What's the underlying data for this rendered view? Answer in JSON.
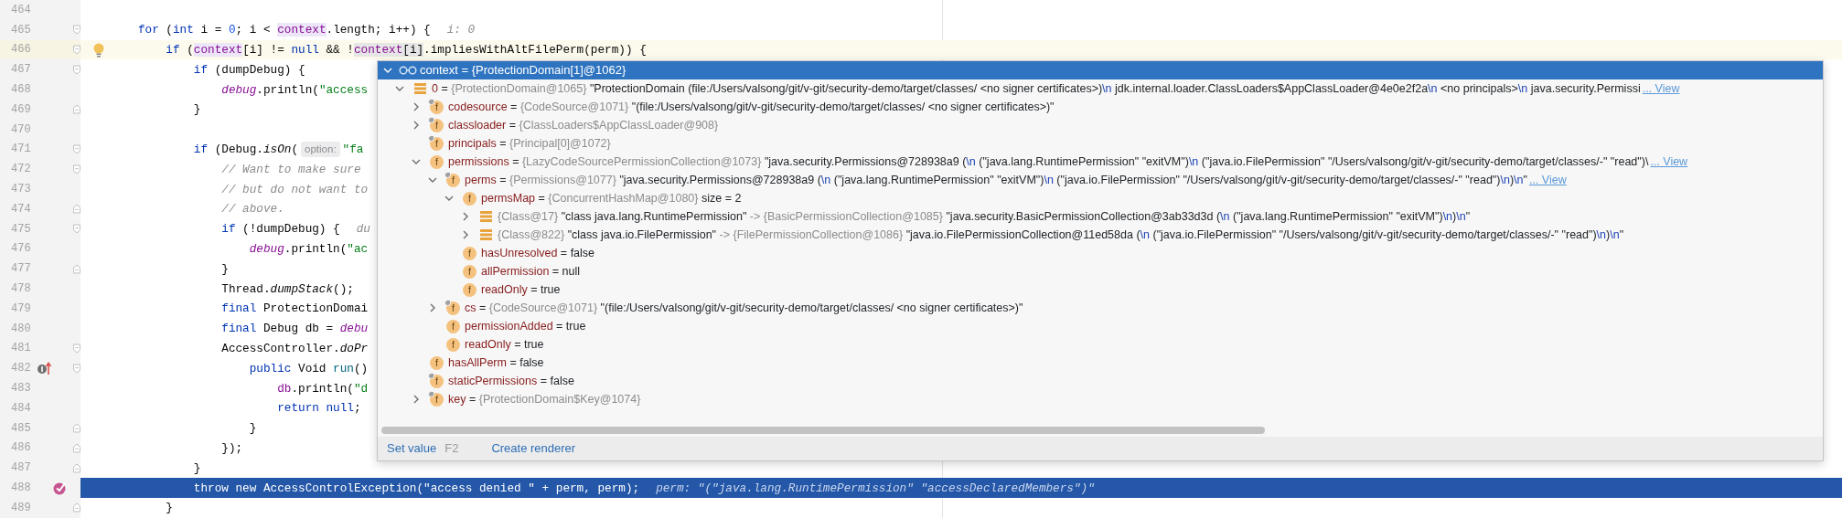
{
  "editor": {
    "lines": [
      {
        "number": "464",
        "caret_line": false,
        "selected": false
      },
      {
        "number": "465",
        "caret_line": false,
        "selected": false,
        "fold_marker": {
          "kind": "start"
        },
        "parts": [
          {
            "kind": "code",
            "tokens": [
              {
                "text": "for",
                "kind": "keyword"
              },
              {
                "text": " (",
                "kind": "plain"
              },
              {
                "text": "int",
                "kind": "keyword"
              },
              {
                "text": " i = ",
                "kind": "plain"
              },
              {
                "text": "0",
                "kind": "number"
              },
              {
                "text": "; i < ",
                "kind": "plain"
              },
              {
                "text": "context",
                "kind": "usage"
              },
              {
                "text": ".length; i++) {",
                "kind": "plain"
              }
            ]
          },
          {
            "kind": "value-hint",
            "text": "i: 0"
          }
        ],
        "children": [
          {
            "number": "466",
            "caret_line": true,
            "selected": false,
            "fold_marker": {
              "kind": "start"
            },
            "gutter_icon": {
              "kind": "bulb"
            },
            "parts": [
              {
                "kind": "code",
                "tokens": [
                  {
                    "text": "if",
                    "kind": "keyword"
                  },
                  {
                    "text": " (",
                    "kind": "plain"
                  },
                  {
                    "text": "context",
                    "kind": "usage"
                  },
                  {
                    "text": "[i] != ",
                    "kind": "plain"
                  },
                  {
                    "text": "null",
                    "kind": "keyword"
                  },
                  {
                    "text": " && !",
                    "kind": "plain"
                  },
                  {
                    "text": "context",
                    "kind": "evaluated-field"
                  },
                  {
                    "text": "[i]",
                    "kind": "evaluated"
                  },
                  {
                    "text": ".impliesWithAltFilePerm(perm)) {",
                    "kind": "plain"
                  }
                ]
              }
            ],
            "children": [
              {
                "number": "467",
                "caret_line": false,
                "selected": false,
                "fold_marker": {
                  "kind": "start"
                },
                "parts": [
                  {
                    "kind": "code",
                    "tokens": [
                      {
                        "text": "if",
                        "kind": "keyword"
                      },
                      {
                        "text": " (dumpDebug) {",
                        "kind": "plain"
                      }
                    ]
                  }
                ],
                "children": [
                  {
                    "number": "468",
                    "caret_line": false,
                    "selected": false,
                    "parts": [
                      {
                        "kind": "code",
                        "tokens": [
                          {
                            "text": "debug",
                            "kind": "static-field"
                          },
                          {
                            "text": ".println(",
                            "kind": "plain"
                          },
                          {
                            "text": "\"access",
                            "kind": "string"
                          }
                        ]
                      }
                    ]
                  }
                ]
              },
              {
                "number": "469",
                "caret_line": false,
                "selected": false,
                "fold_marker": {
                  "kind": "end"
                },
                "parts": [
                  {
                    "kind": "code",
                    "tokens": [
                      {
                        "text": "}",
                        "kind": "plain"
                      }
                    ]
                  }
                ]
              },
              {
                "number": "470",
                "caret_line": false,
                "selected": false
              },
              {
                "number": "471",
                "caret_line": false,
                "selected": false,
                "fold_marker": {
                  "kind": "start"
                },
                "parts": [
                  {
                    "kind": "code",
                    "tokens": [
                      {
                        "text": "if",
                        "kind": "keyword"
                      },
                      {
                        "text": " (Debug.",
                        "kind": "plain"
                      },
                      {
                        "text": "isOn",
                        "kind": "static-call"
                      },
                      {
                        "text": "(",
                        "kind": "plain"
                      }
                    ]
                  },
                  {
                    "kind": "param-hint",
                    "text": "option:"
                  },
                  {
                    "kind": "code",
                    "tokens": [
                      {
                        "text": "\"fa",
                        "kind": "string"
                      }
                    ]
                  }
                ],
                "children": [
                  {
                    "number": "472",
                    "caret_line": false,
                    "selected": false,
                    "fold_marker": {
                      "kind": "start"
                    },
                    "parts": [
                      {
                        "kind": "code",
                        "tokens": [
                          {
                            "text": "// Want to make sure",
                            "kind": "comment"
                          }
                        ]
                      }
                    ]
                  },
                  {
                    "number": "473",
                    "caret_line": false,
                    "selected": false,
                    "parts": [
                      {
                        "kind": "code",
                        "tokens": [
                          {
                            "text": "// but do not want to",
                            "kind": "comment"
                          }
                        ]
                      }
                    ]
                  },
                  {
                    "number": "474",
                    "caret_line": false,
                    "selected": false,
                    "fold_marker": {
                      "kind": "end"
                    },
                    "parts": [
                      {
                        "kind": "code",
                        "tokens": [
                          {
                            "text": "// above.",
                            "kind": "comment"
                          }
                        ]
                      }
                    ]
                  },
                  {
                    "number": "475",
                    "caret_line": false,
                    "selected": false,
                    "fold_marker": {
                      "kind": "start"
                    },
                    "parts": [
                      {
                        "kind": "code",
                        "tokens": [
                          {
                            "text": "if",
                            "kind": "keyword"
                          },
                          {
                            "text": " (!dumpDebug) {",
                            "kind": "plain"
                          }
                        ]
                      },
                      {
                        "kind": "value-hint",
                        "text": "du"
                      }
                    ],
                    "children": [
                      {
                        "number": "476",
                        "caret_line": false,
                        "selected": false,
                        "parts": [
                          {
                            "kind": "code",
                            "tokens": [
                              {
                                "text": "debug",
                                "kind": "static-field"
                              },
                              {
                                "text": ".println(",
                                "kind": "plain"
                              },
                              {
                                "text": "\"ac",
                                "kind": "string"
                              }
                            ]
                          }
                        ]
                      }
                    ]
                  },
                  {
                    "number": "477",
                    "caret_line": false,
                    "selected": false,
                    "fold_marker": {
                      "kind": "end"
                    },
                    "parts": [
                      {
                        "kind": "code",
                        "tokens": [
                          {
                            "text": "}",
                            "kind": "plain"
                          }
                        ]
                      }
                    ]
                  },
                  {
                    "number": "478",
                    "caret_line": false,
                    "selected": false,
                    "parts": [
                      {
                        "kind": "code",
                        "tokens": [
                          {
                            "text": "Thread.",
                            "kind": "plain"
                          },
                          {
                            "text": "dumpStack",
                            "kind": "static-call"
                          },
                          {
                            "text": "();",
                            "kind": "plain"
                          }
                        ]
                      }
                    ]
                  },
                  {
                    "number": "479",
                    "caret_line": false,
                    "selected": false,
                    "parts": [
                      {
                        "kind": "code",
                        "tokens": [
                          {
                            "text": "final",
                            "kind": "keyword"
                          },
                          {
                            "text": " ProtectionDomai",
                            "kind": "plain"
                          }
                        ]
                      }
                    ]
                  },
                  {
                    "number": "480",
                    "caret_line": false,
                    "selected": false,
                    "parts": [
                      {
                        "kind": "code",
                        "tokens": [
                          {
                            "text": "final",
                            "kind": "keyword"
                          },
                          {
                            "text": " Debug db = ",
                            "kind": "plain"
                          },
                          {
                            "text": "debu",
                            "kind": "static-field"
                          }
                        ]
                      }
                    ]
                  },
                  {
                    "number": "481",
                    "caret_line": false,
                    "selected": false,
                    "fold_marker": {
                      "kind": "start"
                    },
                    "parts": [
                      {
                        "kind": "code",
                        "tokens": [
                          {
                            "text": "AccessController.",
                            "kind": "plain"
                          },
                          {
                            "text": "doPr",
                            "kind": "static-call"
                          }
                        ]
                      }
                    ],
                    "children": [
                      {
                        "number": "482",
                        "caret_line": false,
                        "selected": false,
                        "fold_marker": {
                          "kind": "start"
                        },
                        "gutter_icon": {
                          "kind": "override"
                        },
                        "parts": [
                          {
                            "kind": "code",
                            "tokens": [
                              {
                                "text": "public",
                                "kind": "keyword"
                              },
                              {
                                "text": " Void ",
                                "kind": "plain"
                              },
                              {
                                "text": "run",
                                "kind": "method"
                              },
                              {
                                "text": "()",
                                "kind": "plain"
                              }
                            ]
                          }
                        ],
                        "children": [
                          {
                            "number": "483",
                            "caret_line": false,
                            "selected": false,
                            "parts": [
                              {
                                "kind": "code",
                                "tokens": [
                                  {
                                    "text": "db",
                                    "kind": "field"
                                  },
                                  {
                                    "text": ".println(",
                                    "kind": "plain"
                                  },
                                  {
                                    "text": "\"d",
                                    "kind": "string"
                                  }
                                ]
                              }
                            ]
                          },
                          {
                            "number": "484",
                            "caret_line": false,
                            "selected": false,
                            "parts": [
                              {
                                "kind": "code",
                                "tokens": [
                                  {
                                    "text": "return",
                                    "kind": "keyword"
                                  },
                                  {
                                    "text": " null",
                                    "kind": "keyword"
                                  },
                                  {
                                    "text": ";",
                                    "kind": "plain"
                                  }
                                ]
                              }
                            ]
                          }
                        ]
                      },
                      {
                        "number": "485",
                        "caret_line": false,
                        "selected": false,
                        "fold_marker": {
                          "kind": "end"
                        },
                        "parts": [
                          {
                            "kind": "code",
                            "tokens": [
                              {
                                "text": "}",
                                "kind": "plain"
                              }
                            ]
                          }
                        ]
                      }
                    ]
                  },
                  {
                    "number": "486",
                    "caret_line": false,
                    "selected": false,
                    "fold_marker": {
                      "kind": "end"
                    },
                    "parts": [
                      {
                        "kind": "code",
                        "tokens": [
                          {
                            "text": "});",
                            "kind": "plain"
                          }
                        ]
                      }
                    ]
                  }
                ]
              },
              {
                "number": "487",
                "caret_line": false,
                "selected": false,
                "fold_marker": {
                  "kind": "end"
                },
                "parts": [
                  {
                    "kind": "code",
                    "tokens": [
                      {
                        "text": "}",
                        "kind": "plain"
                      }
                    ]
                  }
                ]
              },
              {
                "number": "488",
                "caret_line": false,
                "selected": true,
                "gutter_icon": {
                  "kind": "breakpoint"
                },
                "parts": [
                  {
                    "kind": "code",
                    "tokens": [
                      {
                        "text": "throw",
                        "kind": "keyword"
                      },
                      {
                        "text": " new",
                        "kind": "keyword"
                      },
                      {
                        "text": " AccessControlException(",
                        "kind": "plain"
                      },
                      {
                        "text": "\"access denied \"",
                        "kind": "string"
                      },
                      {
                        "text": " + perm, perm);",
                        "kind": "plain"
                      }
                    ]
                  },
                  {
                    "kind": "value-hint",
                    "text": "perm: \"(\"java.lang.RuntimePermission\" \"accessDeclaredMembers\")\""
                  }
                ]
              }
            ]
          },
          {
            "number": "489",
            "caret_line": false,
            "selected": false,
            "fold_marker": {
              "kind": "end"
            },
            "parts": [
              {
                "kind": "code",
                "tokens": [
                  {
                    "text": "}",
                    "kind": "plain"
                  }
                ]
              }
            ]
          }
        ]
      }
    ]
  },
  "popup": {
    "header": {
      "expanded": true,
      "name": "context",
      "sep": "=",
      "type": "{ProtectionDomain[1]@1062}"
    },
    "nodes": [
      {
        "kind": "element",
        "expanded": true,
        "name": "0",
        "sep": "=",
        "type": "{ProtectionDomain@1065}",
        "value": "\"ProtectionDomain  (file:/Users/valsong/git/v-git/security-demo/target/classes/ <no signer certificates>)\\n jdk.internal.loader.ClassLoaders$AppClassLoader@4e0e2f2a\\n <no principals>\\n java.security.Permissi",
        "link": "... View",
        "children": [
          {
            "kind": "field",
            "badge": "f",
            "final": true,
            "expanded": false,
            "name": "codesource",
            "sep": "=",
            "type": "{CodeSource@1071}",
            "value": "\"(file:/Users/valsong/git/v-git/security-demo/target/classes/ <no signer certificates>)\""
          },
          {
            "kind": "field",
            "badge": "f",
            "final": true,
            "expanded": false,
            "name": "classloader",
            "sep": "=",
            "type": "{ClassLoaders$AppClassLoader@908}"
          },
          {
            "kind": "field",
            "badge": "f",
            "final": true,
            "name": "principals",
            "sep": "=",
            "type": "{Principal[0]@1072}"
          },
          {
            "kind": "field",
            "badge": "f",
            "final": false,
            "expanded": true,
            "name": "permissions",
            "sep": "=",
            "type": "{LazyCodeSourcePermissionCollection@1073}",
            "value": "\"java.security.Permissions@728938a9 (\\n (\"java.lang.RuntimePermission\" \"exitVM\")\\n (\"java.io.FilePermission\" \"/Users/valsong/git/v-git/security-demo/target/classes/-\" \"read\")\\",
            "link": "... View",
            "children": [
              {
                "kind": "field",
                "badge": "f",
                "final": true,
                "expanded": true,
                "name": "perms",
                "sep": "=",
                "type": "{Permissions@1077}",
                "value": "\"java.security.Permissions@728938a9 (\\n (\"java.lang.RuntimePermission\" \"exitVM\")\\n (\"java.io.FilePermission\" \"/Users/valsong/git/v-git/security-demo/target/classes/-\" \"read\")\\n)\\n\"",
                "link": "... View",
                "children": [
                  {
                    "kind": "field",
                    "badge": "f",
                    "final": false,
                    "expanded": true,
                    "name": "permsMap",
                    "sep": "=",
                    "type": "{ConcurrentHashMap@1080}",
                    "value": "size = 2",
                    "children": [
                      {
                        "kind": "entry",
                        "expanded": false,
                        "key_type": "{Class@17}",
                        "key_value": "\"class java.lang.RuntimePermission\"",
                        "arrow": "->",
                        "type": "{BasicPermissionCollection@1085}",
                        "value": "\"java.security.BasicPermissionCollection@3ab33d3d (\\n (\"java.lang.RuntimePermission\" \"exitVM\")\\n)\\n\""
                      },
                      {
                        "kind": "entry",
                        "expanded": false,
                        "key_type": "{Class@822}",
                        "key_value": "\"class java.io.FilePermission\"",
                        "arrow": "->",
                        "type": "{FilePermissionCollection@1086}",
                        "value": "\"java.io.FilePermissionCollection@11ed58da (\\n (\"java.io.FilePermission\" \"/Users/valsong/git/v-git/security-demo/target/classes/-\" \"read\")\\n)\\n\""
                      }
                    ]
                  },
                  {
                    "kind": "field",
                    "badge": "f",
                    "final": false,
                    "name": "hasUnresolved",
                    "sep": "=",
                    "value": "false"
                  },
                  {
                    "kind": "field",
                    "badge": "f",
                    "final": false,
                    "name": "allPermission",
                    "sep": "=",
                    "value": "null"
                  },
                  {
                    "kind": "field",
                    "badge": "f",
                    "final": false,
                    "name": "readOnly",
                    "sep": "=",
                    "value": "true"
                  }
                ]
              },
              {
                "kind": "field",
                "badge": "f",
                "final": true,
                "expanded": false,
                "name": "cs",
                "sep": "=",
                "type": "{CodeSource@1071}",
                "value": "\"(file:/Users/valsong/git/v-git/security-demo/target/classes/ <no signer certificates>)\""
              },
              {
                "kind": "field",
                "badge": "f",
                "final": false,
                "name": "permissionAdded",
                "sep": "=",
                "value": "true"
              },
              {
                "kind": "field",
                "badge": "f",
                "final": false,
                "name": "readOnly",
                "sep": "=",
                "value": "true"
              }
            ]
          },
          {
            "kind": "field",
            "badge": "f",
            "final": false,
            "name": "hasAllPerm",
            "sep": "=",
            "value": "false"
          },
          {
            "kind": "field",
            "badge": "f",
            "final": true,
            "name": "staticPermissions",
            "sep": "=",
            "value": "false"
          },
          {
            "kind": "field",
            "badge": "f",
            "final": true,
            "expanded": false,
            "name": "key",
            "sep": "=",
            "type": "{ProtectionDomain$Key@1074}"
          }
        ]
      }
    ],
    "footer": [
      {
        "label": "Set value",
        "shortcut": "F2"
      },
      {
        "label": "Create renderer"
      }
    ]
  }
}
